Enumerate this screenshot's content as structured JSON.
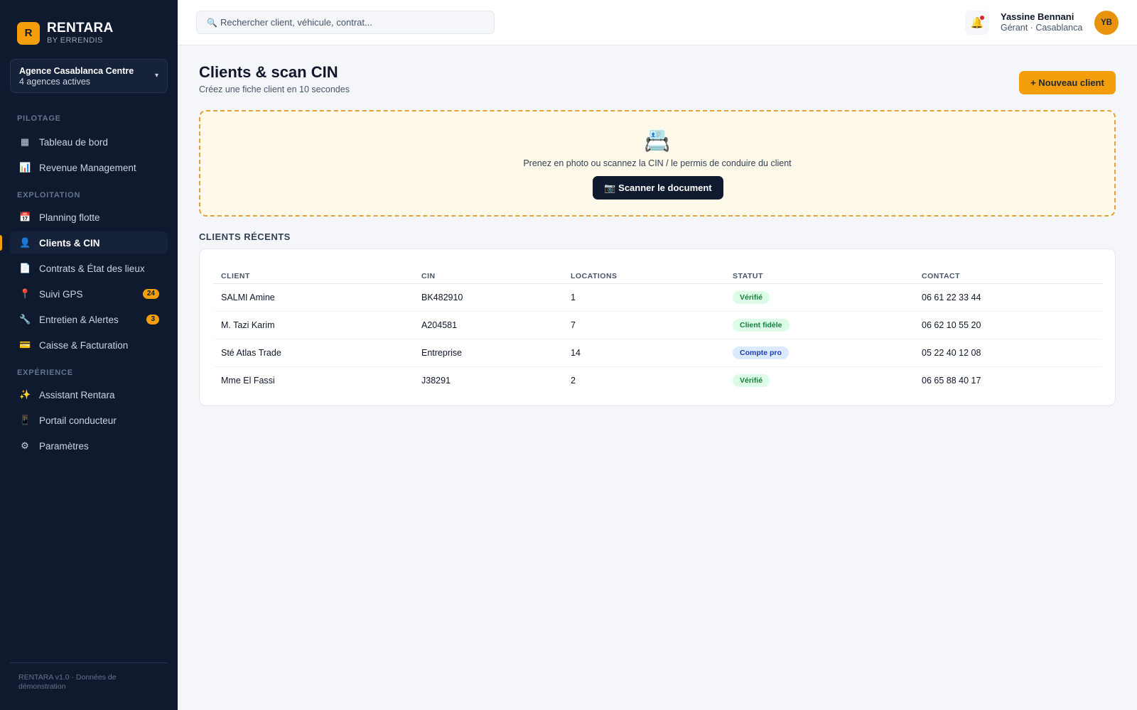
{
  "brand": {
    "logo_letter": "R",
    "name": "RENTARA",
    "sub": "BY ERRENDIS"
  },
  "agency": {
    "name": "Agence Casablanca Centre",
    "sub": "4 agences actives",
    "caret": "▾"
  },
  "sidebar": {
    "sections": [
      {
        "label": "PILOTAGE"
      },
      {
        "label": "EXPLOITATION"
      },
      {
        "label": "EXPÉRIENCE"
      }
    ],
    "items": [
      {
        "label": "Tableau de bord",
        "icon": "▦"
      },
      {
        "label": "Revenue Management",
        "icon": "📊"
      },
      {
        "label": "Planning flotte",
        "icon": "📅"
      },
      {
        "label": "Clients & CIN",
        "icon": "👤"
      },
      {
        "label": "Contrats & État des lieux",
        "icon": "📄"
      },
      {
        "label": "Suivi GPS",
        "icon": "📍",
        "badge": "24"
      },
      {
        "label": "Entretien & Alertes",
        "icon": "🔧",
        "badge": "3"
      },
      {
        "label": "Caisse & Facturation",
        "icon": "💳"
      },
      {
        "label": "Assistant Rentara",
        "icon": "✨"
      },
      {
        "label": "Portail conducteur",
        "icon": "📱"
      },
      {
        "label": "Paramètres",
        "icon": "⚙"
      }
    ],
    "active_index": 3,
    "footer": "RENTARA v1.0 · Données de démonstration"
  },
  "topbar": {
    "search_icon": "🔍",
    "search_placeholder": "Rechercher client, véhicule, contrat...",
    "bell_icon": "🔔",
    "user_name": "Yassine Bennani",
    "user_role": "Gérant · Casablanca",
    "avatar_initials": "YB"
  },
  "main": {
    "title": "Clients & scan CIN",
    "subtitle": "Créez une fiche client en 10 secondes",
    "new_button": "+ Nouveau client",
    "scan": {
      "icon": "📇",
      "text": "Prenez en photo ou scannez la CIN / le permis de conduire du client",
      "button": "📷 Scanner le document"
    },
    "recent_title": "CLIENTS RÉCENTS",
    "table": {
      "headers": [
        "CLIENT",
        "CIN",
        "LOCATIONS",
        "STATUT",
        "CONTACT"
      ],
      "rows": [
        {
          "client": "SALMI Amine",
          "cin": "BK482910",
          "locations": "1",
          "statut": "Vérifié",
          "statut_color": "green",
          "contact": "06 61 22 33 44"
        },
        {
          "client": "M. Tazi Karim",
          "cin": "A204581",
          "locations": "7",
          "statut": "Client fidèle",
          "statut_color": "green",
          "contact": "06 62 10 55 20"
        },
        {
          "client": "Sté Atlas Trade",
          "cin": "Entreprise",
          "locations": "14",
          "statut": "Compte pro",
          "statut_color": "blue",
          "contact": "05 22 40 12 08"
        },
        {
          "client": "Mme El Fassi",
          "cin": "J38291",
          "locations": "2",
          "statut": "Vérifié",
          "statut_color": "green",
          "contact": "06 65 88 40 17"
        }
      ]
    }
  },
  "colors": {
    "accent": "#f59e0b",
    "sidebar_bg": "#0f1a2e",
    "page_bg": "#f4f6f9"
  }
}
